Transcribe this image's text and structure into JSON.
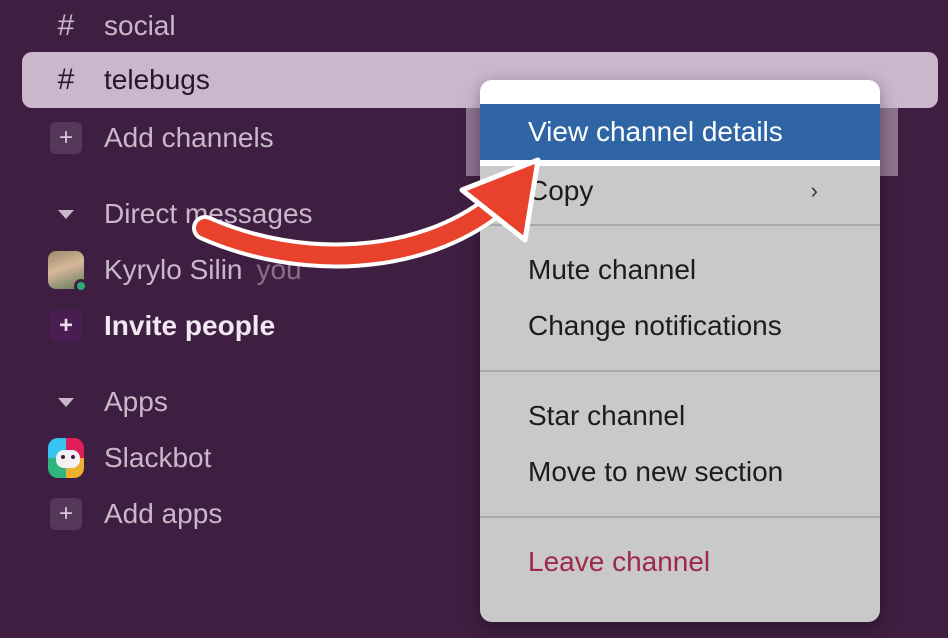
{
  "sidebar": {
    "channels": [
      {
        "label": "social",
        "icon": "hash-icon"
      },
      {
        "label": "telebugs",
        "icon": "hash-icon"
      }
    ],
    "add_channels": "Add channels",
    "direct_messages": {
      "header": "Direct messages",
      "user": {
        "name": "Kyrylo Silin",
        "suffix": "you"
      },
      "invite": "Invite people"
    },
    "apps": {
      "header": "Apps",
      "slackbot": "Slackbot",
      "add_apps": "Add apps"
    }
  },
  "context_menu": {
    "items": [
      {
        "label": "View channel details",
        "state": "highlighted"
      },
      {
        "label": "Copy",
        "has_submenu": true,
        "chevron": "›"
      },
      {
        "label": "Mute channel"
      },
      {
        "label": "Change notifications"
      },
      {
        "label": "Star channel"
      },
      {
        "label": "Move to new section"
      },
      {
        "label": "Leave channel",
        "color": "#9e2849"
      }
    ]
  },
  "colors": {
    "sidebar_bg": "#3f1f41",
    "highlight": "#2f65a5",
    "arrow": "#e8412c",
    "danger": "#9e2849"
  }
}
